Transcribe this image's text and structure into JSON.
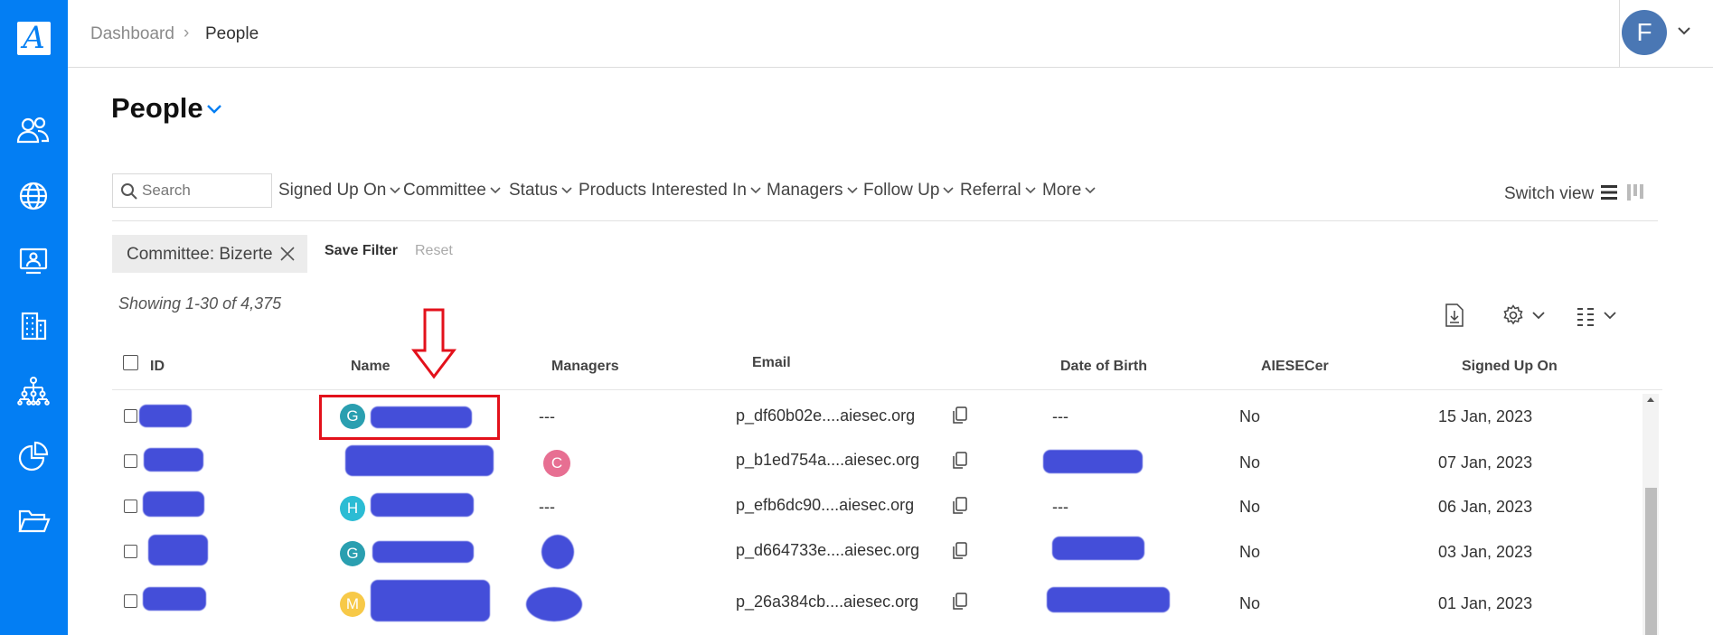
{
  "app": {
    "logo_letter": "A",
    "brand_color": "#037ef3"
  },
  "sidebar": {
    "items": [
      {
        "name": "people-icon"
      },
      {
        "name": "globe-icon"
      },
      {
        "name": "presentation-icon"
      },
      {
        "name": "building-icon"
      },
      {
        "name": "org-chart-icon"
      },
      {
        "name": "pie-chart-icon"
      },
      {
        "name": "folder-icon"
      }
    ]
  },
  "header": {
    "breadcrumb": [
      "Dashboard",
      "People"
    ],
    "user_initial": "F",
    "avatar_color": "#4a77b4"
  },
  "page": {
    "title": "People"
  },
  "search": {
    "placeholder": "Search"
  },
  "filters": [
    "Signed Up On",
    "Committee",
    "Status",
    "Products Interested In",
    "Managers",
    "Follow Up",
    "Referral",
    "More"
  ],
  "view": {
    "switch_label": "Switch view"
  },
  "active_filter": {
    "chip_label": "Committee: Bizerte",
    "save_label": "Save Filter",
    "reset_label": "Reset"
  },
  "results": {
    "showing": "Showing  1-30 of 4,375"
  },
  "table": {
    "columns": [
      "ID",
      "Name",
      "Managers",
      "Email",
      "Date of Birth",
      "AIESECer",
      "Signed Up On"
    ],
    "rows": [
      {
        "initial": "G",
        "initial_color": "#2a9fb0",
        "managers": "---",
        "email": "p_df60b02e....aiesec.org",
        "dob": "---",
        "aiesecer": "No",
        "signed_up": "15 Jan, 2023"
      },
      {
        "initial": "",
        "initial_color": "",
        "managers": "C",
        "email": "p_b1ed754a....aiesec.org",
        "dob": "",
        "aiesecer": "No",
        "signed_up": "07 Jan, 2023"
      },
      {
        "initial": "H",
        "initial_color": "#2bbcd4",
        "managers": "---",
        "email": "p_efb6dc90....aiesec.org",
        "dob": "---",
        "aiesecer": "No",
        "signed_up": "06 Jan, 2023"
      },
      {
        "initial": "G",
        "initial_color": "#2a9fb0",
        "managers": "",
        "email": "p_d664733e....aiesec.org",
        "dob": "",
        "aiesecer": "No",
        "signed_up": "03 Jan, 2023"
      },
      {
        "initial": "M",
        "initial_color": "#f7c948",
        "managers": "",
        "email": "p_26a384cb....aiesec.org",
        "dob": "",
        "aiesecer": "No",
        "signed_up": "01 Jan, 2023"
      }
    ]
  },
  "annotation": {
    "color": "#e3111b"
  }
}
